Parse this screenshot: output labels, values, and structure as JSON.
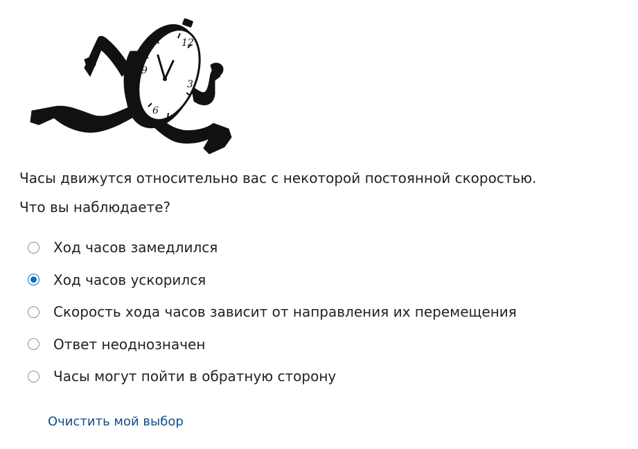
{
  "question": {
    "line1": "Часы движутся относительно вас с некоторой постоянной скоростью.",
    "line2": "Что вы наблюдаете?"
  },
  "answers": [
    {
      "label": "Ход часов замедлился",
      "selected": false
    },
    {
      "label": "Ход часов ускорился",
      "selected": true
    },
    {
      "label": "Скорость хода часов зависит от направления их перемещения",
      "selected": false
    },
    {
      "label": "Ответ неоднозначен",
      "selected": false
    },
    {
      "label": "Часы могут пойти в обратную сторону",
      "selected": false
    }
  ],
  "clock": {
    "numerals": [
      "12",
      "3",
      "6",
      "9"
    ]
  },
  "clear_choice_label": "Очистить мой выбор",
  "colors": {
    "accent": "#0f6cbf",
    "link": "#0f4d8a",
    "text": "#1d2125"
  }
}
